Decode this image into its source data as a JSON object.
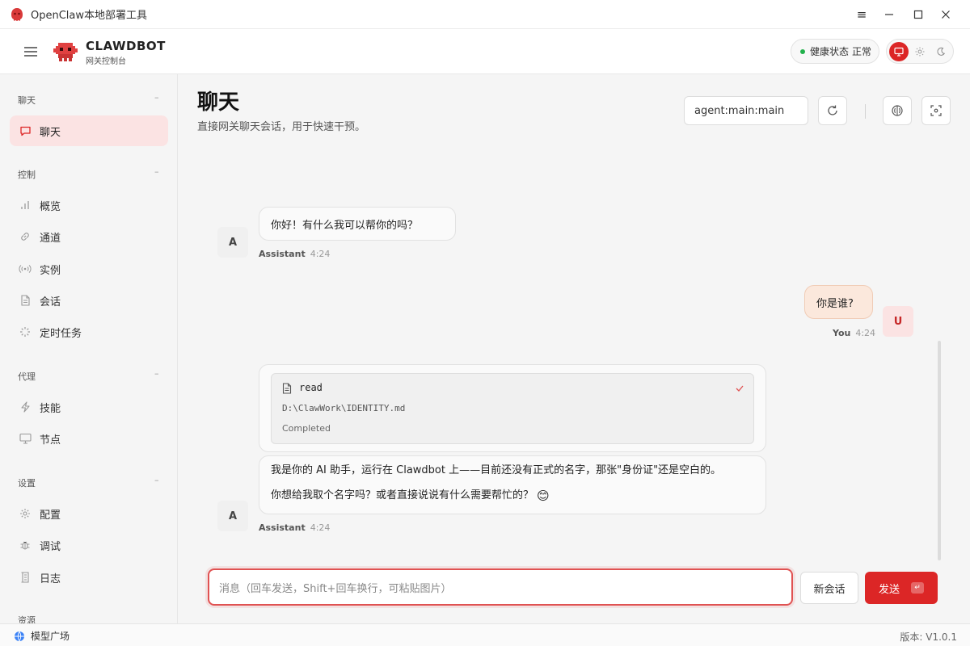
{
  "window": {
    "title": "OpenClaw本地部署工具",
    "controls": {
      "settings": "≡",
      "minimize": "—",
      "maximize": "☐",
      "close": "✕"
    }
  },
  "header": {
    "brand_name": "CLAWDBOT",
    "brand_sub": "网关控制台",
    "health_label": "健康状态",
    "health_value": "正常",
    "theme_options": [
      "monitor-icon",
      "sun-icon",
      "moon-icon"
    ],
    "theme_selected": "monitor-icon"
  },
  "sidebar": {
    "sections": [
      {
        "title": "聊天",
        "collapse": "–",
        "items": [
          {
            "label": "聊天",
            "icon": "chat-bubble-icon",
            "active": true
          }
        ]
      },
      {
        "title": "控制",
        "collapse": "–",
        "items": [
          {
            "label": "概览",
            "icon": "bar-chart-icon"
          },
          {
            "label": "通道",
            "icon": "link-icon"
          },
          {
            "label": "实例",
            "icon": "broadcast-icon"
          },
          {
            "label": "会话",
            "icon": "file-icon"
          },
          {
            "label": "定时任务",
            "icon": "loader-icon"
          }
        ]
      },
      {
        "title": "代理",
        "collapse": "–",
        "items": [
          {
            "label": "技能",
            "icon": "bolt-icon"
          },
          {
            "label": "节点",
            "icon": "monitor-icon"
          }
        ]
      },
      {
        "title": "设置",
        "collapse": "–",
        "items": [
          {
            "label": "配置",
            "icon": "gear-icon"
          },
          {
            "label": "调试",
            "icon": "bug-icon"
          },
          {
            "label": "日志",
            "icon": "scroll-icon"
          }
        ]
      },
      {
        "title": "资源",
        "collapse": "",
        "items": []
      }
    ]
  },
  "main": {
    "title": "聊天",
    "subtitle": "直接网关聊天会话，用于快速干预。",
    "session_key": "agent:main:main",
    "toolbar_icons": [
      "refresh-icon",
      "brain-icon",
      "focus-icon"
    ]
  },
  "chat": {
    "messages": [
      {
        "role": "assistant",
        "avatar": "A",
        "text": "你好！有什么我可以帮你的吗？",
        "sender": "Assistant",
        "time": "4:24"
      },
      {
        "role": "user",
        "avatar": "U",
        "text": "你是谁?",
        "sender": "You",
        "time": "4:24"
      },
      {
        "role": "assistant",
        "avatar": "A",
        "tool_call": {
          "name": "read",
          "path": "D:\\ClawWork\\IDENTITY.md",
          "status": "Completed"
        },
        "text_line1": "我是你的 AI 助手，运行在 Clawdbot 上——目前还没有正式的名字，那张\"身份证\"还是空白的。",
        "text_line2": "你想给我取个名字吗？或者直接说说有什么需要帮忙的？",
        "emoji": "😊",
        "sender": "Assistant",
        "time": "4:24"
      }
    ]
  },
  "composer": {
    "placeholder": "消息（回车发送，Shift+回车换行，可粘贴图片）",
    "value": "",
    "new_session_label": "新会话",
    "send_label": "发送",
    "send_key_glyph": "↵"
  },
  "statusbar": {
    "model_plaza": "模型广场",
    "version": "版本: V1.0.1"
  },
  "colors": {
    "accent": "#dc2626",
    "active_nav_bg": "#fbe3e3",
    "user_bubble_bg": "#fbe8dc",
    "health_dot": "#22b14c"
  }
}
